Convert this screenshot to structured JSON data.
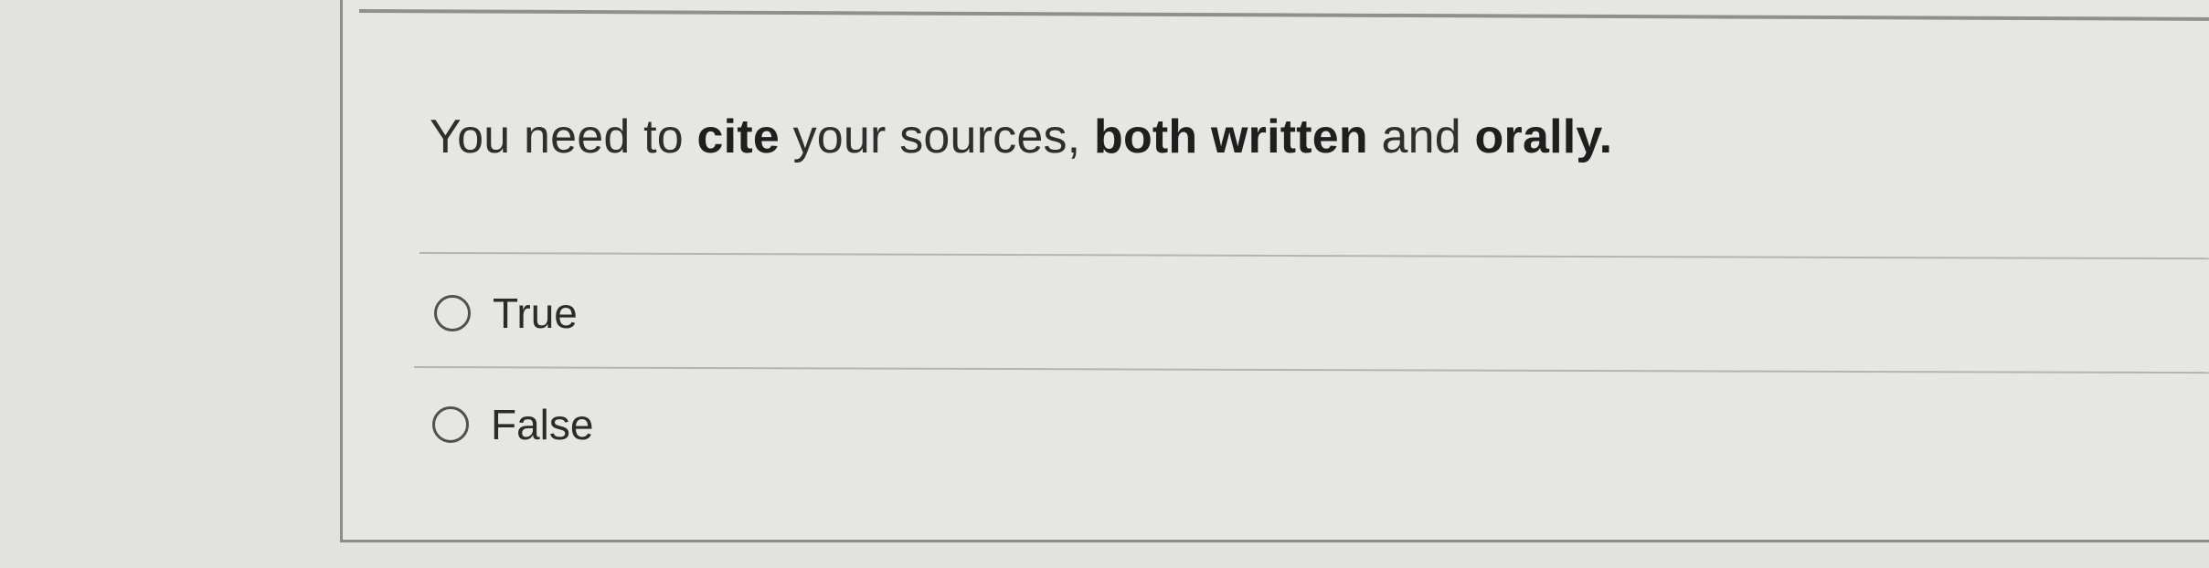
{
  "question": {
    "segments": [
      {
        "text": "You need to ",
        "bold": false
      },
      {
        "text": "cite",
        "bold": true
      },
      {
        "text": " your sources, ",
        "bold": false
      },
      {
        "text": "both written",
        "bold": true
      },
      {
        "text": " and ",
        "bold": false
      },
      {
        "text": "orally.",
        "bold": true
      }
    ]
  },
  "options": [
    {
      "label": "True",
      "selected": false
    },
    {
      "label": "False",
      "selected": false
    }
  ]
}
